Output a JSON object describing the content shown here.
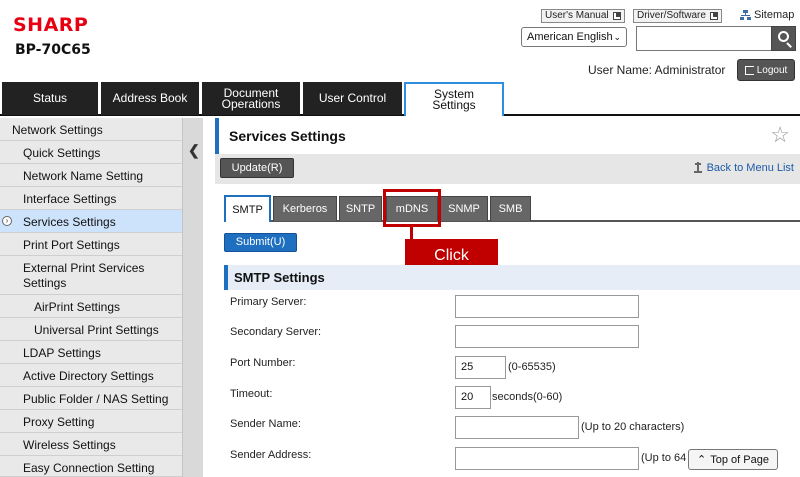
{
  "header": {
    "brand": "SHARP",
    "model": "BP-70C65",
    "users_manual": "User's Manual",
    "driver_software": "Driver/Software",
    "sitemap": "Sitemap",
    "language": "American English",
    "search_value": "",
    "user_name": "User Name: Administrator",
    "logout": "Logout"
  },
  "nav": {
    "tabs": [
      {
        "label": "Status"
      },
      {
        "label": "Address Book"
      },
      {
        "label": "Document Operations"
      },
      {
        "label": "User Control"
      },
      {
        "label": "System Settings"
      }
    ],
    "active": "System Settings"
  },
  "sidebar": {
    "items": [
      {
        "label": "Network Settings"
      },
      {
        "label": "Quick Settings"
      },
      {
        "label": "Network Name Setting"
      },
      {
        "label": "Interface Settings"
      },
      {
        "label": "Services Settings"
      },
      {
        "label": "Print Port Settings"
      },
      {
        "label": "External Print Services Settings"
      },
      {
        "label": "AirPrint Settings"
      },
      {
        "label": "Universal Print Settings"
      },
      {
        "label": "LDAP Settings"
      },
      {
        "label": "Active Directory Settings"
      },
      {
        "label": "Public Folder / NAS Setting"
      },
      {
        "label": "Proxy Setting"
      },
      {
        "label": "Wireless Settings"
      },
      {
        "label": "Easy Connection Setting"
      }
    ],
    "selected": "Services Settings"
  },
  "content": {
    "title": "Services Settings",
    "update_button": "Update(R)",
    "back_link": "Back to Menu List",
    "tabs": [
      {
        "label": "SMTP"
      },
      {
        "label": "Kerberos"
      },
      {
        "label": "SNTP"
      },
      {
        "label": "mDNS"
      },
      {
        "label": "SNMP"
      },
      {
        "label": "SMB"
      }
    ],
    "active_tab": "SMTP",
    "callout": "Click",
    "submit_button": "Submit(U)",
    "section_title": "SMTP Settings",
    "fields": {
      "primary_server": {
        "label": "Primary Server:",
        "value": ""
      },
      "secondary_server": {
        "label": "Secondary Server:",
        "value": ""
      },
      "port_number": {
        "label": "Port Number:",
        "value": "25",
        "hint": "(0-65535)"
      },
      "timeout": {
        "label": "Timeout:",
        "value": "20",
        "hint": "seconds(0-60)"
      },
      "sender_name": {
        "label": "Sender Name:",
        "value": "",
        "hint": "(Up to 20 characters)"
      },
      "sender_address": {
        "label": "Sender Address:",
        "value": "",
        "hint": "(Up to 64"
      }
    },
    "top_of_page": "Top of Page"
  },
  "colors": {
    "brand_red": "#e60012",
    "accent_blue": "#1f6fc0",
    "callout_red": "#c00000",
    "nav_dark": "#222222"
  }
}
